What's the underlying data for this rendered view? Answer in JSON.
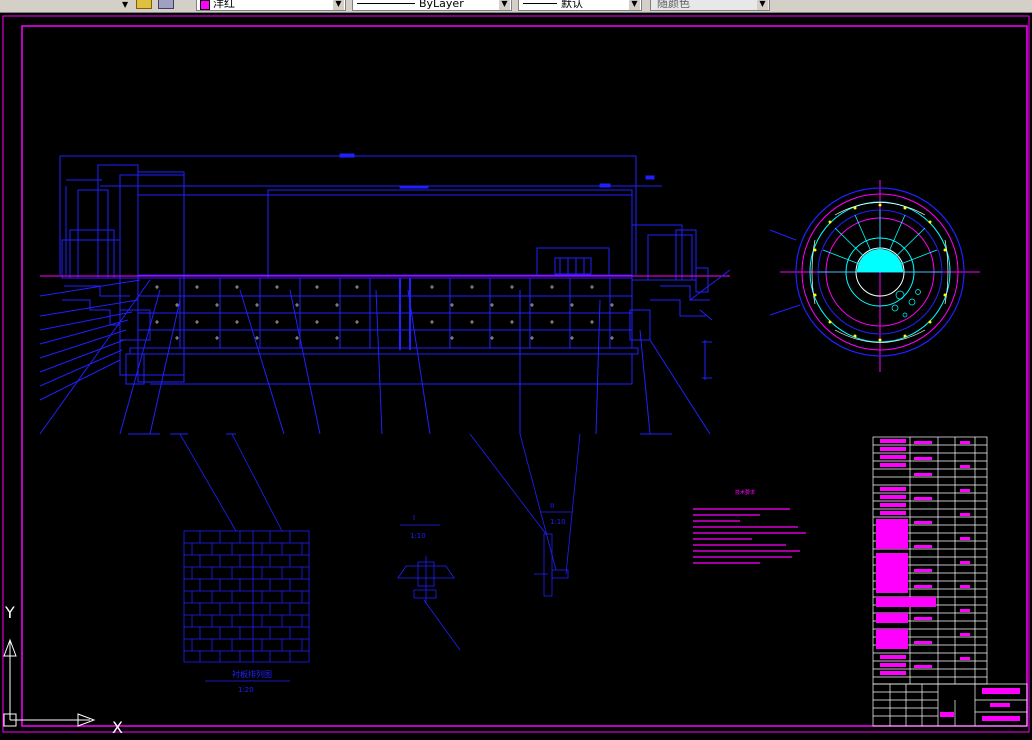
{
  "toolbar": {
    "layer_color_label": "洋红",
    "linetype_label": "ByLayer",
    "lineweight_label": "默认",
    "plotstyle_label": "随颜色",
    "layer_color_hex": "#ff00ff"
  },
  "drawing": {
    "section_i_label": "I",
    "section_i_scale": "1:10",
    "section_ii_label": "II",
    "section_ii_scale": "1:10",
    "lining_title": "衬板排列图",
    "lining_scale": "1:20",
    "notes_title": "技术要求",
    "ucs_y": "Y",
    "ucs_x": "X"
  },
  "colors": {
    "background": "#000000",
    "frame": "#ff00ff",
    "lines": "#2020ff",
    "cyan": "#00ffff",
    "yellow": "#ffff00",
    "white": "#ffffff"
  }
}
